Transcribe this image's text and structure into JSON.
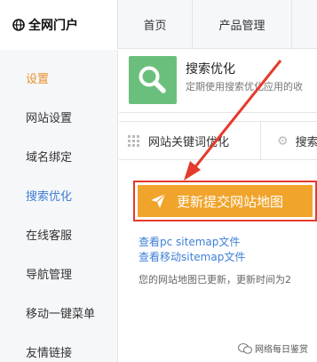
{
  "brand": {
    "title": "全网门户",
    "icon": "globe-icon"
  },
  "nav": {
    "tabs": [
      "首页",
      "产品管理",
      ""
    ]
  },
  "sidebar": {
    "items": [
      "设置",
      "网站设置",
      "域名绑定",
      "搜索优化",
      "在线客服",
      "导航管理",
      "移动一键菜单",
      "友情链接"
    ],
    "active_color": "#e8912b",
    "selected_color": "#3e7fd6"
  },
  "app": {
    "title": "搜索优化",
    "description": "定期使用搜索优化应用的收",
    "icon": "search-icon",
    "icon_bg": "#6bbf7c"
  },
  "tabs": {
    "tab1": "网站关键词优化",
    "tab2": "搜索"
  },
  "submit": {
    "label": "更新提交网站地图",
    "icon": "paper-plane-icon",
    "bg": "#f1a42b",
    "highlight": "#e53b2c"
  },
  "links": {
    "pc": "查看pc sitemap文件",
    "mobile": "查看移动sitemap文件"
  },
  "note": "您的网站地图已更新，更新时间为2",
  "watermark": "网络每日鉴赏"
}
